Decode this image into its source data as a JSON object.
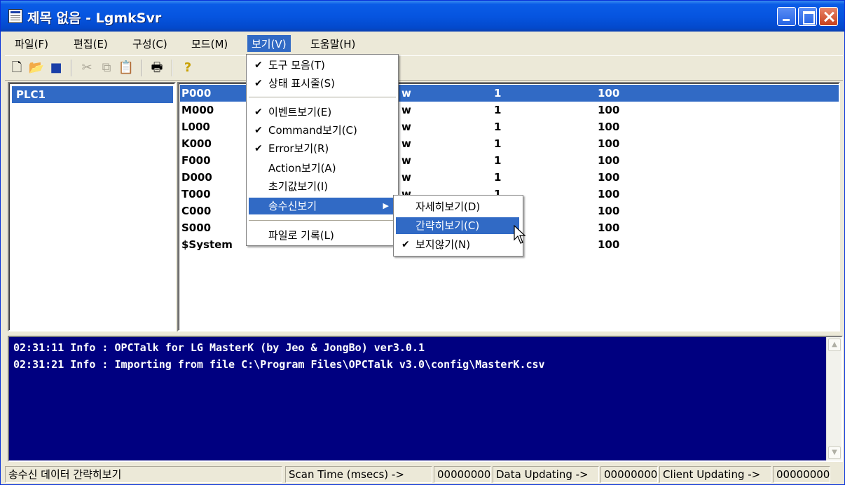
{
  "window": {
    "title": "제목 없음 - LgmkSvr"
  },
  "menubar": {
    "items": [
      "파일(F)",
      "편집(E)",
      "구성(C)",
      "모드(M)",
      "보기(V)",
      "도움말(H)"
    ],
    "active_index": 4
  },
  "toolbar": {
    "icons": [
      "new-file-icon",
      "open-folder-icon",
      "save-icon",
      "cut-icon",
      "copy-icon",
      "paste-icon",
      "print-icon",
      "help-icon"
    ]
  },
  "tree": {
    "items": [
      "PLC1"
    ]
  },
  "list": {
    "rows": [
      {
        "name": "P000",
        "type": "w",
        "one": "1",
        "hundred": "100"
      },
      {
        "name": "M000",
        "type": "w",
        "one": "1",
        "hundred": "100"
      },
      {
        "name": "L000",
        "type": "w",
        "one": "1",
        "hundred": "100"
      },
      {
        "name": "K000",
        "type": "w",
        "one": "1",
        "hundred": "100"
      },
      {
        "name": "F000",
        "type": "w",
        "one": "1",
        "hundred": "100"
      },
      {
        "name": "D000",
        "type": "w",
        "one": "1",
        "hundred": "100"
      },
      {
        "name": "T000",
        "type": "w",
        "one": "1",
        "hundred": "100"
      },
      {
        "name": "C000",
        "type": "",
        "one": "",
        "hundred": "100"
      },
      {
        "name": "S000",
        "type": "",
        "one": "",
        "hundred": "100"
      },
      {
        "name": "$System",
        "type": "",
        "one": "",
        "hundred": "100"
      }
    ]
  },
  "view_menu": {
    "items": [
      {
        "label": "도구 모음(T)",
        "checked": true
      },
      {
        "label": "상태 표시줄(S)",
        "checked": true
      },
      {
        "label": "이벤트보기(E)",
        "checked": true
      },
      {
        "label": "Command보기(C)",
        "checked": true
      },
      {
        "label": "Error보기(R)",
        "checked": true
      },
      {
        "label": "Action보기(A)",
        "checked": false
      },
      {
        "label": "초기값보기(I)",
        "checked": false
      },
      {
        "label": "송수신보기",
        "checked": false
      },
      {
        "label": "파일로 기록(L)",
        "checked": false
      }
    ]
  },
  "submenu": {
    "items": [
      {
        "label": "자세히보기(D)",
        "checked": false
      },
      {
        "label": "간략히보기(C)",
        "checked": false
      },
      {
        "label": "보지않기(N)",
        "checked": true
      }
    ]
  },
  "log": {
    "lines": [
      "02:31:11 Info : OPCTalk for LG MasterK (by Jeo & JongBo) ver3.0.1",
      "02:31:21 Info : Importing from file C:\\Program Files\\OPCTalk v3.0\\config\\MasterK.csv"
    ]
  },
  "statusbar": {
    "message": "송수신 데이터 간략히보기",
    "scan_label": "Scan Time (msecs) ->",
    "scan_value": "00000000",
    "data_label": "Data Updating ->",
    "data_value": "00000000",
    "client_label": "Client Updating ->",
    "client_value": "00000000"
  },
  "colors": {
    "selection": "#316ac5",
    "log_background": "#000080",
    "title_blue": "#0655e0"
  }
}
